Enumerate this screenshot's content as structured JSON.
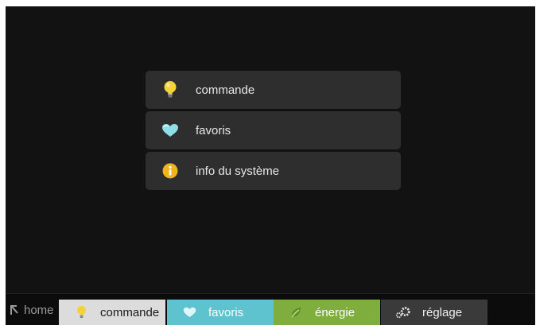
{
  "menu": {
    "items": [
      {
        "label": "commande",
        "icon": "lightbulb-icon"
      },
      {
        "label": "favoris",
        "icon": "heart-icon"
      },
      {
        "label": "info du système",
        "icon": "info-icon"
      }
    ]
  },
  "taskbar": {
    "home_label": "home",
    "tabs": [
      {
        "label": "commande",
        "icon": "lightbulb-icon",
        "color": "#dcdcdc"
      },
      {
        "label": "favoris",
        "icon": "heart-icon",
        "color": "#5ec3cf"
      },
      {
        "label": "énergie",
        "icon": "leaf-icon",
        "color": "#7fae3f"
      },
      {
        "label": "réglage",
        "icon": "gears-icon",
        "color": "#3a3a3a"
      }
    ]
  },
  "colors": {
    "background": "#121212",
    "menu_item": "#2e2e2e",
    "bulb": "#f3d23a",
    "info": "#f1b51c",
    "heart": "#8fdde6"
  }
}
